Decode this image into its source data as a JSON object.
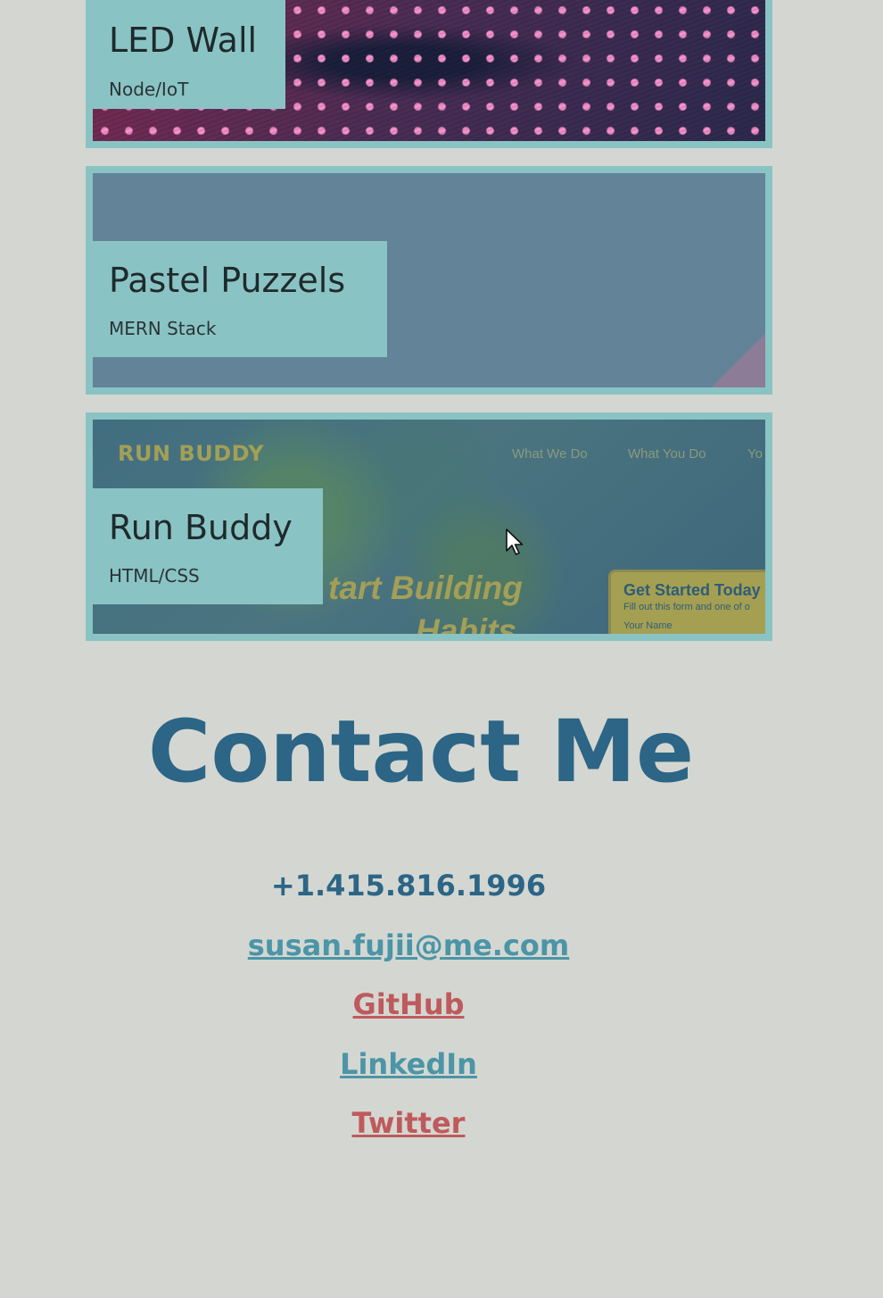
{
  "projects": [
    {
      "title": "LED Wall",
      "tech": "Node/IoT"
    },
    {
      "title": "Pastel Puzzels",
      "tech": "MERN Stack"
    },
    {
      "title": "Run Buddy",
      "tech": "HTML/CSS",
      "preview": {
        "brand": "RUN BUDDY",
        "nav": [
          "What We Do",
          "What You Do",
          "Yo"
        ],
        "hero_line1": "tart Building",
        "hero_line2": "Habits",
        "form_title": "Get Started Today",
        "form_sub": "Fill out this form and one of o",
        "form_field": "Your Name"
      }
    }
  ],
  "contact": {
    "heading": "Contact Me",
    "phone": "+1.415.816.1996",
    "email": "susan.fujii@me.com",
    "github": "GitHub",
    "linkedin": "LinkedIn",
    "twitter": "Twitter"
  },
  "colors": {
    "background": "#d4d7d1",
    "card_border": "#8ac3c4",
    "heading": "#2c6586",
    "link_teal": "#4b95a7",
    "link_red": "#bf5a5c"
  },
  "icons": {
    "cursor": "mouse-pointer-icon"
  }
}
